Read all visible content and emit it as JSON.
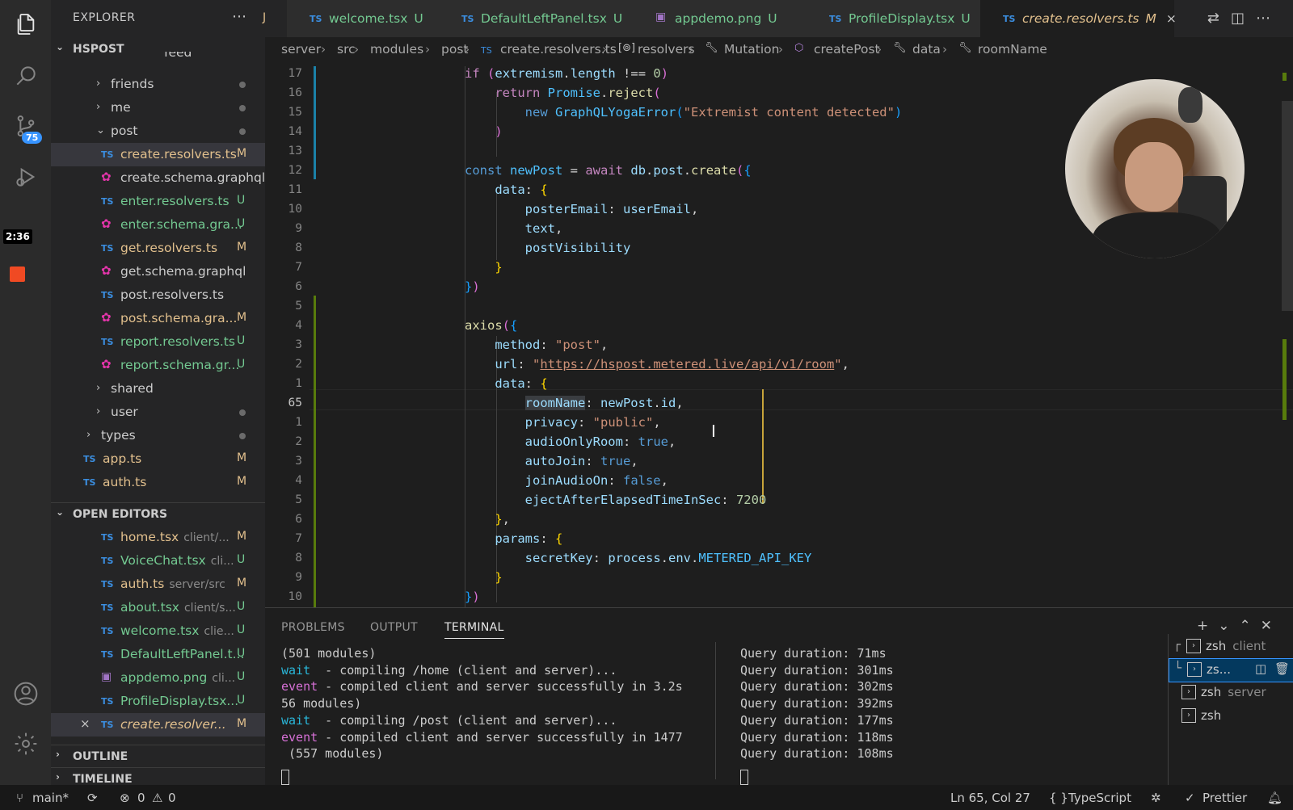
{
  "activity": {
    "badge": "75",
    "timer": "2:36"
  },
  "sidebar": {
    "title": "EXPLORER",
    "tab_peek": "J",
    "root": "HSPOST",
    "truncated_top": "feed",
    "tree": [
      {
        "type": "folder",
        "label": "friends",
        "status": "dot"
      },
      {
        "type": "folder",
        "label": "me",
        "status": "dot"
      },
      {
        "type": "folder-open",
        "label": "post",
        "status": "dot"
      },
      {
        "type": "ts",
        "label": "create.resolvers.ts",
        "status": "M"
      },
      {
        "type": "gql",
        "label": "create.schema.graphql",
        "status": ""
      },
      {
        "type": "ts",
        "label": "enter.resolvers.ts",
        "status": "U"
      },
      {
        "type": "gql",
        "label": "enter.schema.gra...",
        "status": "U"
      },
      {
        "type": "ts",
        "label": "get.resolvers.ts",
        "status": "M"
      },
      {
        "type": "gql",
        "label": "get.schema.graphql",
        "status": ""
      },
      {
        "type": "ts",
        "label": "post.resolvers.ts",
        "status": ""
      },
      {
        "type": "gql",
        "label": "post.schema.gra...",
        "status": "M"
      },
      {
        "type": "ts",
        "label": "report.resolvers.ts",
        "status": "U"
      },
      {
        "type": "gql",
        "label": "report.schema.gr...",
        "status": "U"
      },
      {
        "type": "folder",
        "label": "shared",
        "status": ""
      },
      {
        "type": "folder",
        "label": "user",
        "status": "dot"
      },
      {
        "type": "folder",
        "label": "types",
        "status": "dot"
      },
      {
        "type": "ts",
        "label": "app.ts",
        "status": "M"
      },
      {
        "type": "ts",
        "label": "auth.ts",
        "status": "M"
      }
    ],
    "open_editors_title": "OPEN EDITORS",
    "open_editors": [
      {
        "icon": "ts",
        "name": "home.tsx",
        "path": "client/...",
        "status": "M"
      },
      {
        "icon": "ts",
        "name": "VoiceChat.tsx",
        "path": "cli...",
        "status": "U"
      },
      {
        "icon": "ts",
        "name": "auth.ts",
        "path": "server/src",
        "status": "M"
      },
      {
        "icon": "ts",
        "name": "about.tsx",
        "path": "client/s...",
        "status": "U"
      },
      {
        "icon": "ts",
        "name": "welcome.tsx",
        "path": "clie...",
        "status": "U"
      },
      {
        "icon": "ts",
        "name": "DefaultLeftPanel.t...",
        "path": "",
        "status": "U"
      },
      {
        "icon": "img",
        "name": "appdemo.png",
        "path": "cli...",
        "status": "U"
      },
      {
        "icon": "ts",
        "name": "ProfileDisplay.tsx...",
        "path": "",
        "status": "U"
      },
      {
        "icon": "ts",
        "name": "create.resolver...",
        "path": "",
        "status": "M",
        "close": "×"
      }
    ],
    "outline": "OUTLINE",
    "timeline": "TIMELINE"
  },
  "tabs": [
    {
      "icon": "TS",
      "label": "welcome.tsx",
      "status": "U"
    },
    {
      "icon": "TS",
      "label": "DefaultLeftPanel.tsx",
      "status": "U"
    },
    {
      "icon": "img",
      "label": "appdemo.png",
      "status": "U"
    },
    {
      "icon": "TS",
      "label": "ProfileDisplay.tsx",
      "status": "U"
    },
    {
      "icon": "TS",
      "label": "create.resolvers.ts",
      "status": "M",
      "close": "×"
    }
  ],
  "breadcrumb": [
    "server",
    "src",
    "modules",
    "post",
    "create.resolvers.ts",
    "resolvers",
    "Mutation",
    "createPost",
    "data",
    "roomName"
  ],
  "editor": {
    "line_numbers": [
      "17",
      "16",
      "15",
      "14",
      "13",
      "12",
      "11",
      "10",
      "9",
      "8",
      "7",
      "6",
      "5",
      "4",
      "3",
      "2",
      "1",
      "65",
      "1",
      "2",
      "3",
      "4",
      "5",
      "6",
      "7",
      "8",
      "9",
      "10"
    ],
    "current_line": "65"
  },
  "panel": {
    "tabs": [
      "PROBLEMS",
      "OUTPUT",
      "TERMINAL"
    ],
    "active_tab": "TERMINAL",
    "term_left": [
      {
        "kw": "",
        "text": "(501 modules)"
      },
      {
        "kw": "wait",
        "text": "  - compiling /home (client and server)..."
      },
      {
        "kw": "event",
        "text": " - compiled client and server successfully in 3.2s"
      },
      {
        "kw": "",
        "text": "56 modules)"
      },
      {
        "kw": "wait",
        "text": "  - compiling /post (client and server)..."
      },
      {
        "kw": "event",
        "text": " - compiled client and server successfully in 1477"
      },
      {
        "kw": "",
        "text": " (557 modules)"
      }
    ],
    "term_right": [
      "Query duration: 71ms",
      "Query duration: 301ms",
      "Query duration: 302ms",
      "Query duration: 392ms",
      "Query duration: 177ms",
      "Query duration: 118ms",
      "Query duration: 108ms"
    ],
    "terminals": [
      {
        "label": "zsh",
        "suffix": "client"
      },
      {
        "label": "zs...",
        "suffix": ""
      },
      {
        "label": "zsh",
        "suffix": "server"
      },
      {
        "label": "zsh",
        "suffix": ""
      }
    ]
  },
  "status": {
    "branch": "main*",
    "errors": "0",
    "warnings": "0",
    "position": "Ln 65, Col 27",
    "language": "TypeScript",
    "formatter": "Prettier"
  }
}
